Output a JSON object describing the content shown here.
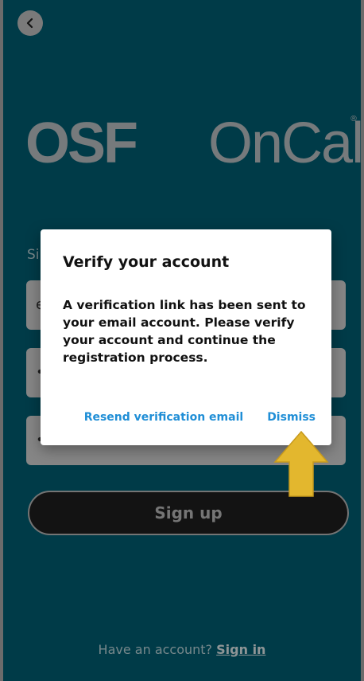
{
  "logo": {
    "part1": "OSF",
    "part2": "OnCall",
    "registered": "®"
  },
  "form": {
    "section_label": "Si",
    "fields": [
      {
        "value": "e"
      },
      {
        "value": "•"
      },
      {
        "value": "•"
      }
    ],
    "signup_label": "Sign up"
  },
  "footer": {
    "prompt": "Have an account?",
    "link": "Sign in"
  },
  "dialog": {
    "title": "Verify your account",
    "body": "A verification link has been sent to your email account. Please verify your account and continue the registration process.",
    "resend_label": "Resend verification email",
    "dismiss_label": "Dismiss"
  },
  "colors": {
    "background": "#005f74",
    "link": "#1f8ed6",
    "arrow": "#e3b72e"
  }
}
